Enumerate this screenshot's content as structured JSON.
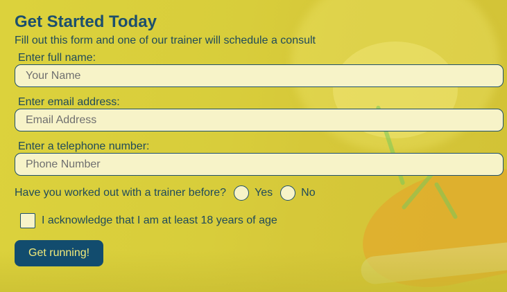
{
  "form": {
    "title": "Get Started Today",
    "subtitle": "Fill out this form and one of our trainer will schedule a consult",
    "fields": {
      "name": {
        "label": "Enter full name:",
        "placeholder": "Your Name",
        "value": ""
      },
      "email": {
        "label": "Enter email address:",
        "placeholder": "Email Address",
        "value": ""
      },
      "phone": {
        "label": "Enter a telephone number:",
        "placeholder": "Phone Number",
        "value": ""
      }
    },
    "trainer_question": {
      "label": "Have you worked out with a trainer before?",
      "options": [
        "Yes",
        "No"
      ],
      "selected": null
    },
    "age_ack": {
      "label": "I acknowledge that I am at least 18 years of age",
      "checked": false
    },
    "submit_label": "Get running!"
  },
  "colors": {
    "background": "#d9cf3a",
    "accent": "#124c6e",
    "title": "#1d4f6d",
    "input_bg": "#f7f3c8",
    "button_text": "#f2ea7a"
  },
  "icons": {
    "background_image": "sneaker-lacing-photo"
  }
}
